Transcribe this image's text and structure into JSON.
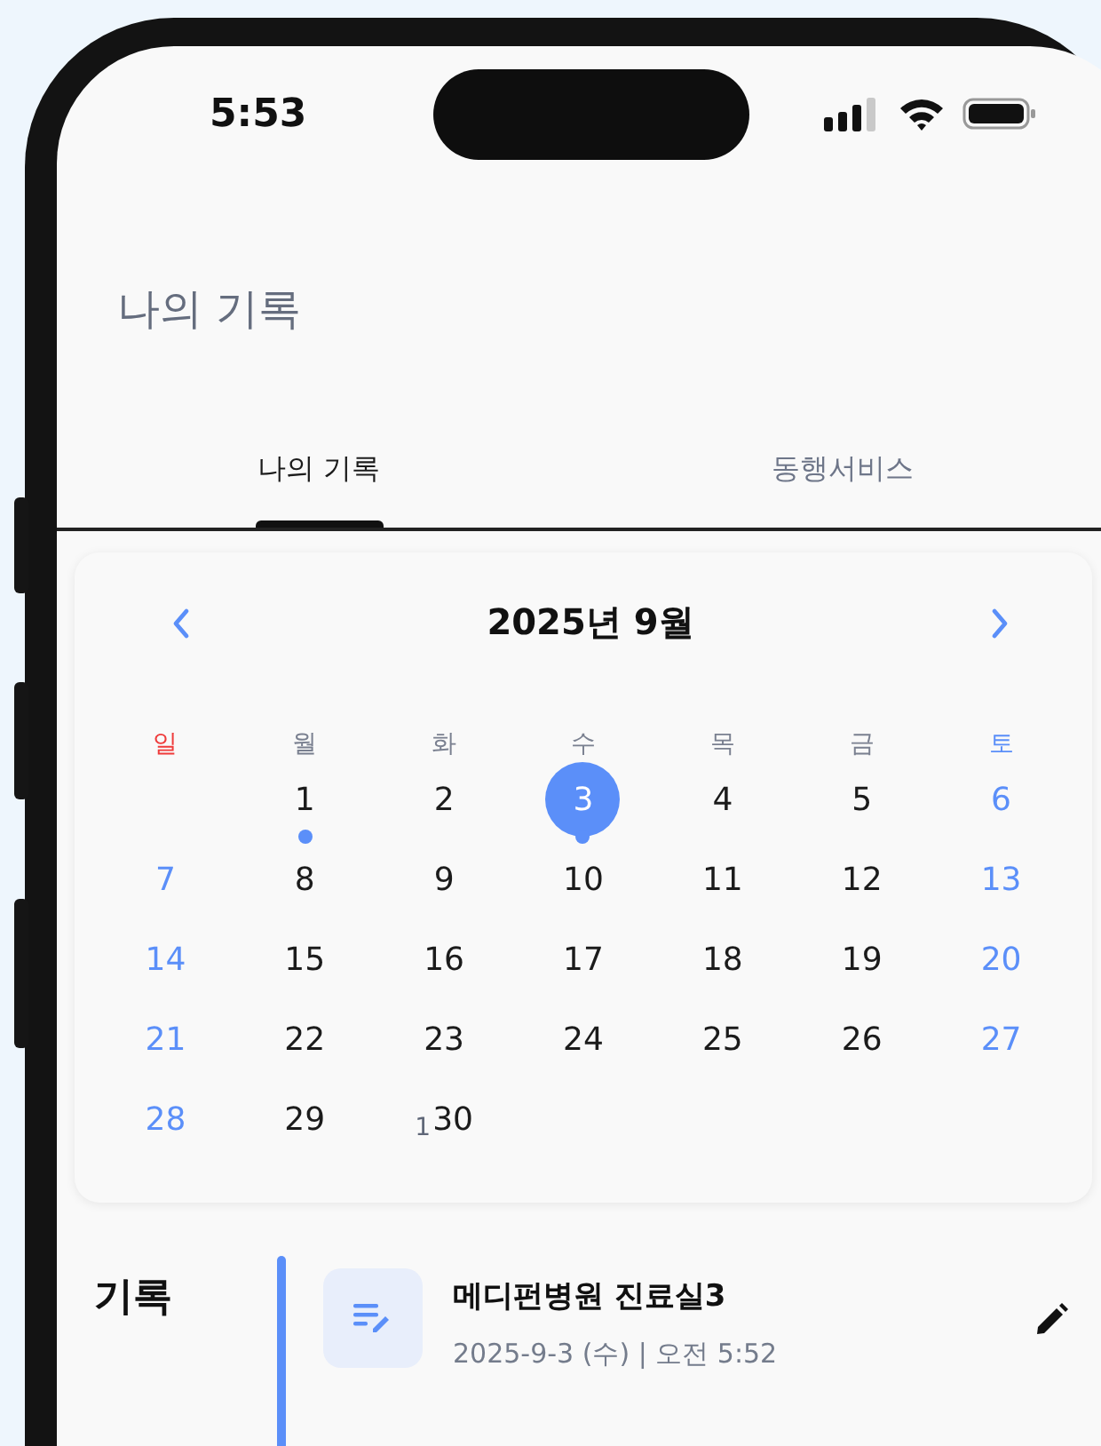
{
  "status_bar": {
    "time": "5:53"
  },
  "header": {
    "title": "나의 기록"
  },
  "tabs": [
    {
      "label": "나의 기록",
      "selected": true
    },
    {
      "label": "동행서비스",
      "selected": false
    }
  ],
  "calendar": {
    "title": "2025년 9월",
    "weekdays": [
      "일",
      "월",
      "화",
      "수",
      "목",
      "금",
      "토"
    ],
    "weeks": [
      [
        {
          "kind": "blank"
        },
        {
          "kind": "day",
          "label": "1",
          "selected": false,
          "has_record": true
        },
        {
          "kind": "day",
          "label": "2",
          "selected": false,
          "has_record": false
        },
        {
          "kind": "day",
          "label": "3",
          "selected": true,
          "has_record": true
        },
        {
          "kind": "day",
          "label": "4",
          "selected": false,
          "has_record": false
        },
        {
          "kind": "day",
          "label": "5",
          "selected": false,
          "has_record": false
        },
        {
          "kind": "day",
          "label": "6",
          "selected": false,
          "has_record": false
        }
      ],
      [
        {
          "kind": "day",
          "label": "7",
          "selected": false,
          "has_record": false
        },
        {
          "kind": "day",
          "label": "8",
          "selected": false,
          "has_record": false
        },
        {
          "kind": "day",
          "label": "9",
          "selected": false,
          "has_record": false
        },
        {
          "kind": "day",
          "label": "10",
          "selected": false,
          "has_record": false
        },
        {
          "kind": "day",
          "label": "11",
          "selected": false,
          "has_record": false
        },
        {
          "kind": "day",
          "label": "12",
          "selected": false,
          "has_record": false
        },
        {
          "kind": "day",
          "label": "13",
          "selected": false,
          "has_record": false
        }
      ],
      [
        {
          "kind": "day",
          "label": "14",
          "selected": false,
          "has_record": false
        },
        {
          "kind": "day",
          "label": "15",
          "selected": false,
          "has_record": false
        },
        {
          "kind": "day",
          "label": "16",
          "selected": false,
          "has_record": false
        },
        {
          "kind": "day",
          "label": "17",
          "selected": false,
          "has_record": false
        },
        {
          "kind": "day",
          "label": "18",
          "selected": false,
          "has_record": false
        },
        {
          "kind": "day",
          "label": "19",
          "selected": false,
          "has_record": false
        },
        {
          "kind": "day",
          "label": "20",
          "selected": false,
          "has_record": false
        }
      ],
      [
        {
          "kind": "day",
          "label": "21",
          "selected": false,
          "has_record": false
        },
        {
          "kind": "day",
          "label": "22",
          "selected": false,
          "has_record": false
        },
        {
          "kind": "day",
          "label": "23",
          "selected": false,
          "has_record": false
        },
        {
          "kind": "day",
          "label": "24",
          "selected": false,
          "has_record": false
        },
        {
          "kind": "day",
          "label": "25",
          "selected": false,
          "has_record": false
        },
        {
          "kind": "day",
          "label": "26",
          "selected": false,
          "has_record": false
        },
        {
          "kind": "day",
          "label": "27",
          "selected": false,
          "has_record": false
        }
      ],
      [
        {
          "kind": "day",
          "label": "28",
          "selected": false,
          "has_record": false
        },
        {
          "kind": "day",
          "label": "29",
          "selected": false,
          "has_record": false
        },
        {
          "kind": "day",
          "label": "30",
          "note": "1",
          "selected": false,
          "has_record": false
        }
      ]
    ]
  },
  "records": {
    "heading": "기록",
    "items": [
      {
        "title": "메디펀병원 진료실3",
        "subtitle": "2025-9-3 (수) | 오전 5:52"
      }
    ]
  }
}
